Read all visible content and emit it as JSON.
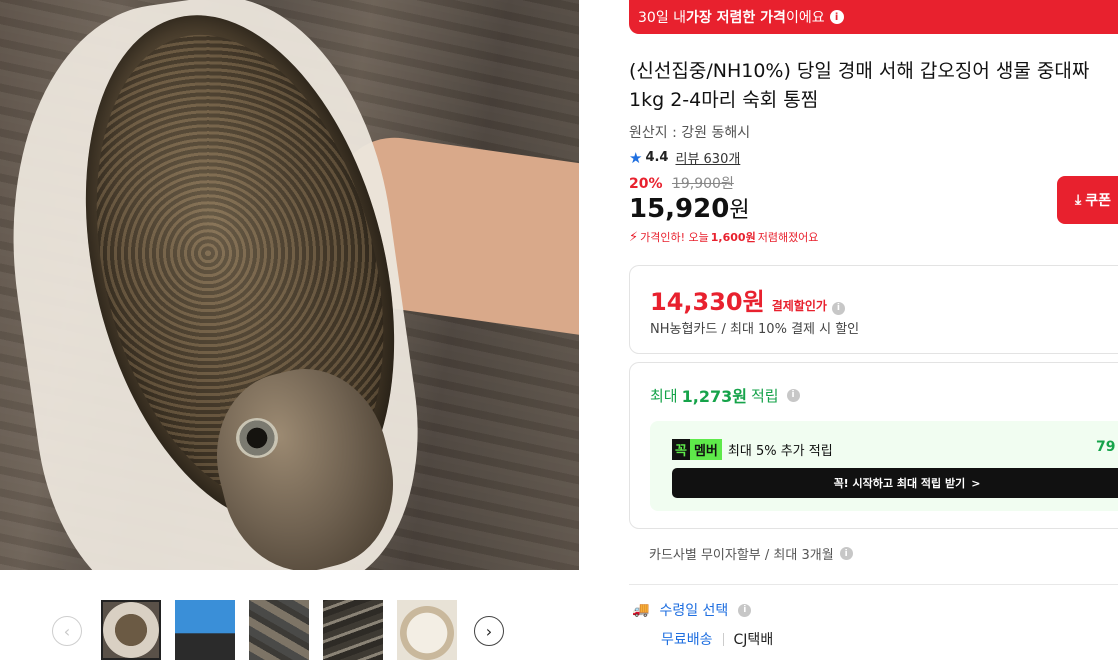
{
  "banner": {
    "prefix": "30일 내 ",
    "strong": "가장 저렴한 가격",
    "suffix": "이에요",
    "info_icon": "info-icon"
  },
  "product": {
    "title": "(신선집중/NH10%) 당일 경매 서해 갑오징어 생물 중대짜 1kg 2-4마리 숙회 통찜",
    "origin": "원산지 : 강원 동해시",
    "rating": "4.4",
    "review_label": "리뷰 630개",
    "discount_pct": "20%",
    "original_price": "19,900원",
    "price_number": "15,920",
    "price_unit": "원",
    "price_drop_prefix": "가격인하! 오늘 ",
    "price_drop_amount": "1,600원",
    "price_drop_suffix": " 저렴해졌어요"
  },
  "coupon_button": {
    "label": "쿠폰",
    "icon": "download-icon"
  },
  "card_discount": {
    "price": "14,330원",
    "label": "결제할인가",
    "sub": "NH농협카드 / 최대 10% 결제 시 할인"
  },
  "points": {
    "prefix": "최대 ",
    "amount": "1,273원",
    "suffix": " 적립",
    "member_tag_a": "꼭",
    "member_tag_b": "멤버",
    "member_text": "최대 5% 추가 적립",
    "member_right": "79",
    "member_button": "꼭! 시작하고 최대 적립 받기",
    "member_button_arrow": ">"
  },
  "installment": "카드사별 무이자할부 / 최대 3개월",
  "delivery": {
    "label": "수령일 선택",
    "free": "무료배송",
    "courier": "CJ택배",
    "icon": "truck-icon"
  },
  "gallery": {
    "thumbnails": [
      "갑오징어 손에 든 모습",
      "파란 상자 위 갑오징어",
      "여러 마리 갑오징어",
      "갑오징어 클로즈업",
      "갑오징어 숙회"
    ],
    "active_index": 0,
    "prev": "‹",
    "next": "›"
  },
  "colors": {
    "accent": "#e8212e",
    "blue": "#1f6fe0",
    "green": "#16a34a",
    "member_green": "#5ee94a"
  }
}
